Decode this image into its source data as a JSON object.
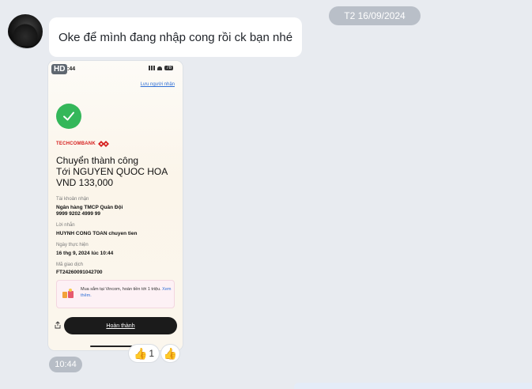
{
  "chat": {
    "date_separator": "T2 16/09/2024",
    "message_text": "Oke để mình đang nhập cong rồi ck bạn nhé",
    "message_time": "10:44",
    "reactions": [
      {
        "emoji": "👍",
        "count": "1"
      },
      {
        "emoji": "👍",
        "count": ""
      }
    ]
  },
  "image": {
    "hd_badge": "HD",
    "phone_time": ":44",
    "battery": "78",
    "save_recipient": "Lưu người nhận",
    "bank_name": "TECHCOMBANK",
    "title": "Chuyển thành công",
    "recipient_line": "Tới NGUYEN QUOC HOA",
    "amount_line": "VND 133,000",
    "fields": [
      {
        "label": "Tài khoản nhận",
        "value": "Ngân hàng TMCP Quân Đội"
      },
      {
        "label": "",
        "value": "9999 9202 4999 99"
      },
      {
        "label": "Lời nhắn",
        "value": "HUYNH CONG TOAN chuyen tien"
      },
      {
        "label": "Ngày thực hiện",
        "value": "16 thg 9, 2024 lúc 10:44"
      },
      {
        "label": "Mã giao dịch",
        "value": "FT24260091042700"
      }
    ],
    "promo_text": "Mua sắm tại Vincom, hoàn tiền tới 1 triệu.",
    "promo_link": "Xem thêm.",
    "done_button": "Hoàn thành"
  },
  "colors": {
    "background": "#e8ebf0",
    "bubble": "#ffffff",
    "success_green": "#34b75a",
    "brand_red": "#d6201f",
    "link_blue": "#2f6fd6"
  },
  "icons": [
    "check-icon",
    "techcombank-logo-icon",
    "share-icon",
    "thumbs-up-icon",
    "gift-icon"
  ]
}
